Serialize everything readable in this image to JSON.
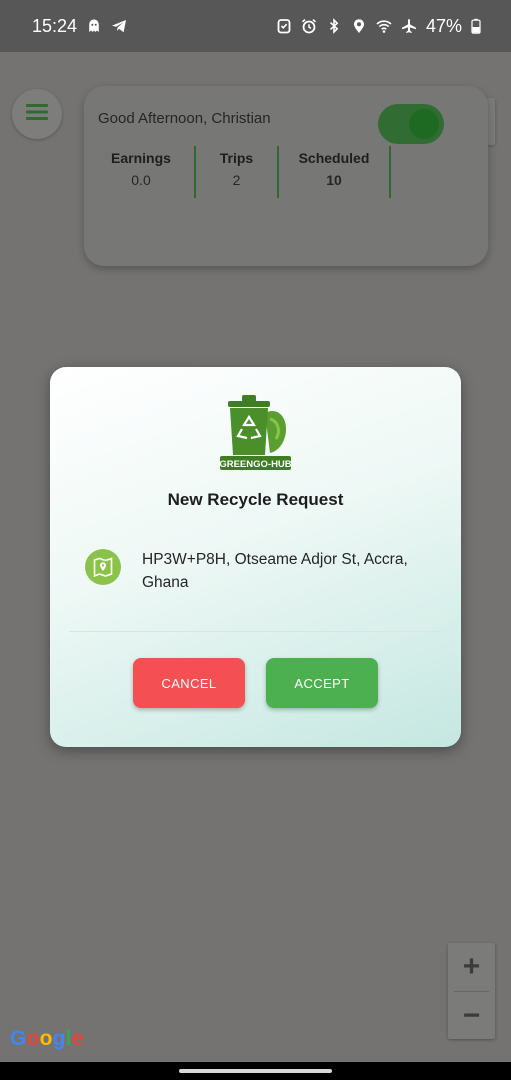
{
  "status_bar": {
    "time": "15:24",
    "battery": "47%",
    "icons_left": [
      "ghost-icon",
      "telegram-icon"
    ],
    "icons_right": [
      "security-icon",
      "alarm-icon",
      "bluetooth-icon",
      "location-icon",
      "wifi-icon",
      "airplane-icon",
      "battery-icon"
    ]
  },
  "map": {
    "provider_logo": "Google",
    "zoom_in_label": "+",
    "zoom_out_label": "−",
    "icons": [
      "my-location-icon"
    ]
  },
  "menu": {
    "icon": "hamburger-menu-icon"
  },
  "summary": {
    "greeting": "Good Afternoon, Christian",
    "online_toggle": {
      "on": true,
      "color": "#2e7d32"
    },
    "stats": [
      {
        "title": "Earnings",
        "value": "0.0"
      },
      {
        "title": "Trips",
        "value": "2"
      },
      {
        "title": "Scheduled",
        "value": "10"
      }
    ]
  },
  "dialog": {
    "logo_text": "GREENGO-HUB",
    "title": "New Recycle Request",
    "address": "HP3W+P8H, Otseame Adjor St, Accra, Ghana",
    "cancel_label": "CANCEL",
    "accept_label": "ACCEPT",
    "icons": [
      "recycle-bin-logo-icon",
      "map-pin-icon"
    ]
  },
  "colors": {
    "accent_green": "#4caf50",
    "cancel_red": "#f44f52",
    "divider_green": "#2e6a2e"
  }
}
